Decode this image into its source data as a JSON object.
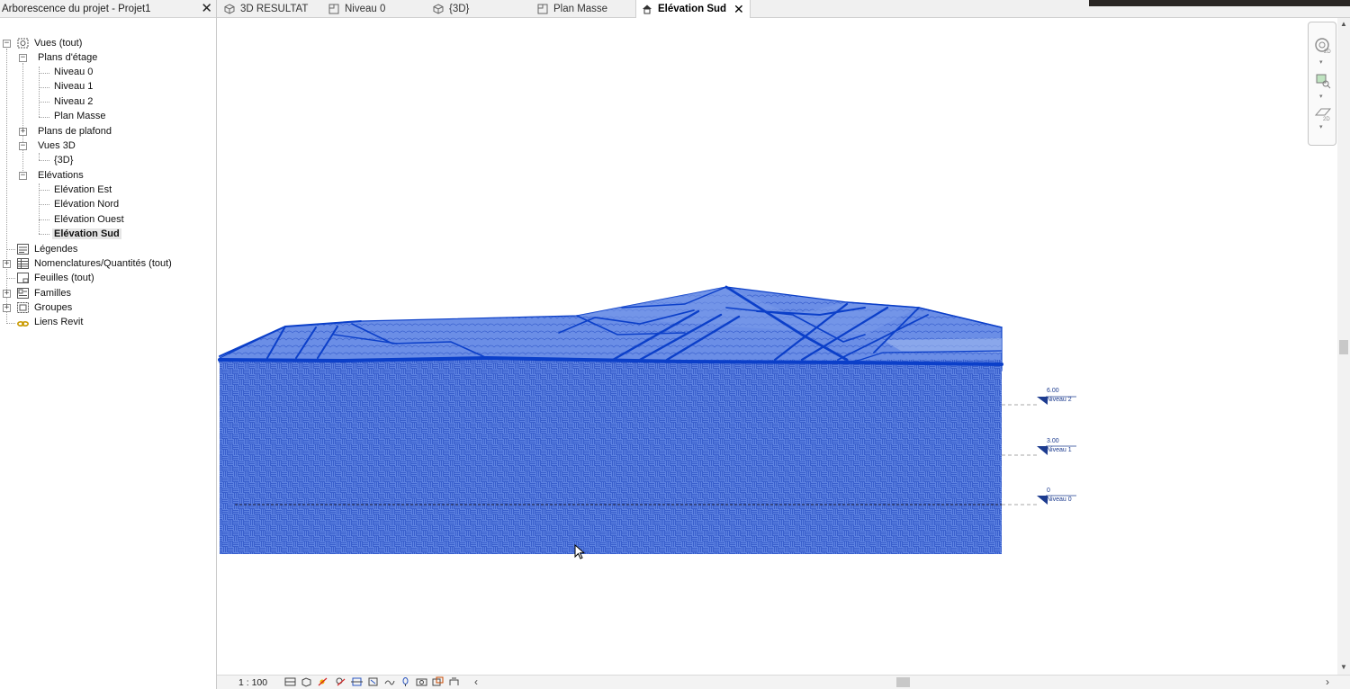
{
  "browser": {
    "title": "Arborescence du projet - Projet1",
    "close_glyph": "✕",
    "tree": {
      "vues": "Vues (tout)",
      "plans_etage": "Plans d'étage",
      "niveau0": "Niveau 0",
      "niveau1": "Niveau 1",
      "niveau2": "Niveau 2",
      "plan_masse": "Plan Masse",
      "plans_plafond": "Plans de plafond",
      "vues3d": "Vues 3D",
      "vue3d": "{3D}",
      "elevations": "Elévations",
      "elev_est": "Elévation Est",
      "elev_nord": "Elévation Nord",
      "elev_ouest": "Elévation Ouest",
      "elev_sud": "Elévation Sud",
      "legendes": "Légendes",
      "nomenclatures": "Nomenclatures/Quantités (tout)",
      "feuilles": "Feuilles (tout)",
      "familles": "Familles",
      "groupes": "Groupes",
      "liens": "Liens Revit"
    }
  },
  "tabs": [
    {
      "label": "3D RESULTAT",
      "icon": "3d-view-icon"
    },
    {
      "label": "Niveau 0",
      "icon": "floor-plan-icon"
    },
    {
      "label": "{3D}",
      "icon": "3d-view-icon"
    },
    {
      "label": "Plan Masse",
      "icon": "floor-plan-icon"
    },
    {
      "label": "Elévation Sud",
      "icon": "elevation-icon",
      "close": "✕",
      "active": true
    }
  ],
  "levels": [
    {
      "elevation": "6.00",
      "name": "Niveau 2"
    },
    {
      "elevation": "3.00",
      "name": "Niveau 1"
    },
    {
      "elevation": "0",
      "name": "Niveau 0"
    }
  ],
  "statusbar": {
    "scale": "1 : 100",
    "left_arrow": "‹",
    "right_arrow": "›"
  },
  "colors": {
    "terrain_fill": "#5b7fe0",
    "terrain_edge": "#0b3fc9",
    "level_marker": "#1c3b8f"
  }
}
